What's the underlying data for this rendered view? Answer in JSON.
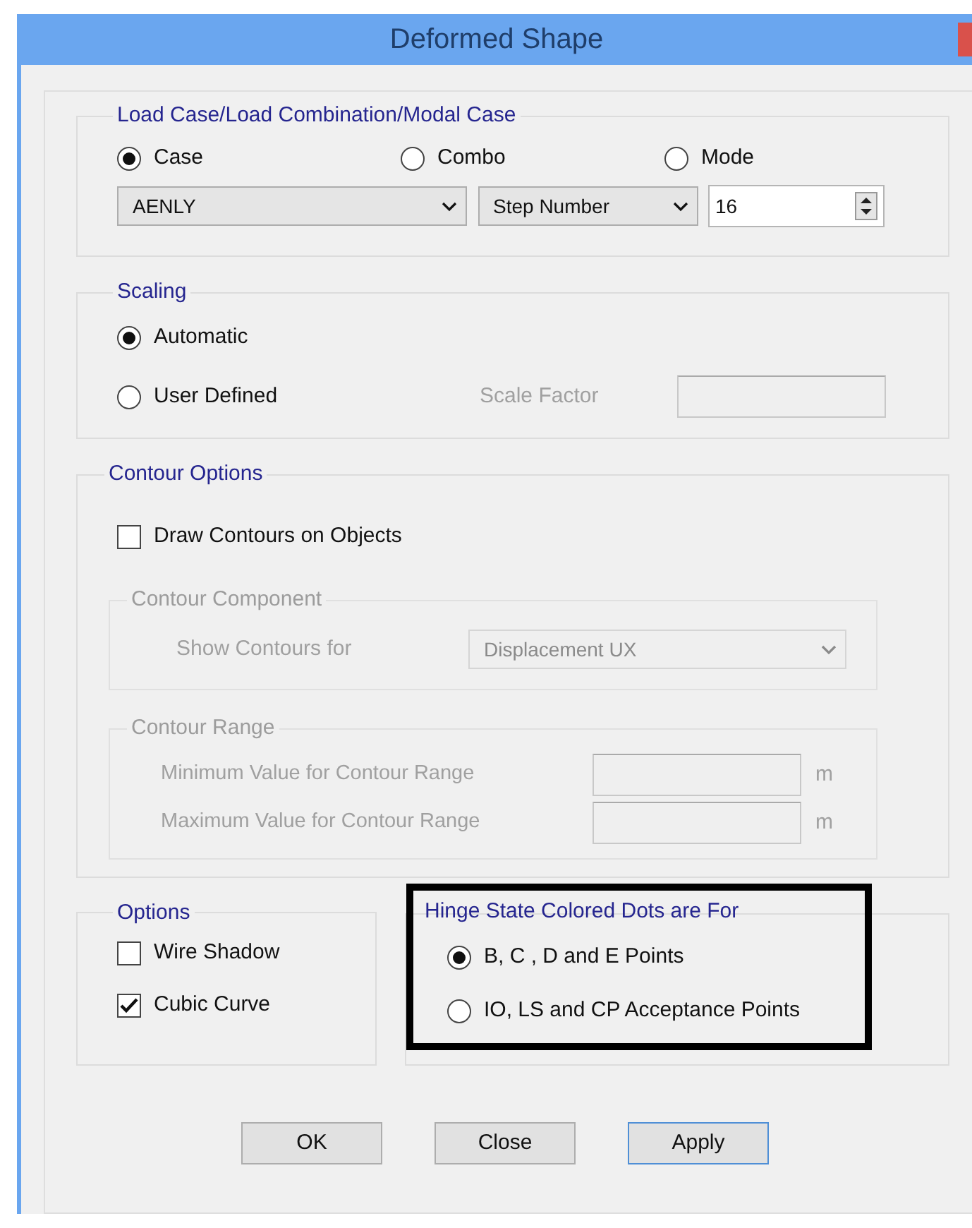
{
  "window": {
    "title": "Deformed Shape"
  },
  "load_case": {
    "title": "Load Case/Load Combination/Modal Case",
    "options": [
      {
        "label": "Case",
        "selected": true
      },
      {
        "label": "Combo",
        "selected": false
      },
      {
        "label": "Mode",
        "selected": false
      }
    ],
    "case_select": "AENLY",
    "step_select": "Step Number",
    "step_value": "16"
  },
  "scaling": {
    "title": "Scaling",
    "options": [
      {
        "label": "Automatic",
        "selected": true
      },
      {
        "label": "User Defined",
        "selected": false
      }
    ],
    "scale_factor": {
      "label": "Scale Factor",
      "disabled": true
    }
  },
  "contour_options": {
    "title": "Contour Options",
    "draw_contours": {
      "label": "Draw Contours on Objects",
      "checked": false
    },
    "component": {
      "title": "Contour Component",
      "label": "Show Contours for",
      "value": "Displacement UX",
      "disabled": true
    },
    "range": {
      "title": "Contour Range",
      "disabled": true,
      "fields": [
        {
          "label": "Minimum Value for Contour Range",
          "unit": "m"
        },
        {
          "label": "Maximum Value for Contour Range",
          "unit": "m"
        }
      ]
    }
  },
  "options": {
    "title": "Options",
    "items": [
      {
        "label": "Wire Shadow",
        "checked": false
      },
      {
        "label": "Cubic Curve",
        "checked": true
      }
    ]
  },
  "hinge_dots": {
    "title": "Hinge State Colored Dots are For",
    "highlighted": true,
    "options": [
      {
        "label": "B, C , D and E Points",
        "selected": true
      },
      {
        "label": "IO, LS and CP Acceptance Points",
        "selected": false
      }
    ]
  },
  "buttons": [
    {
      "label": "OK",
      "default": false
    },
    {
      "label": "Close",
      "default": false
    },
    {
      "label": "Apply",
      "default": true
    }
  ]
}
